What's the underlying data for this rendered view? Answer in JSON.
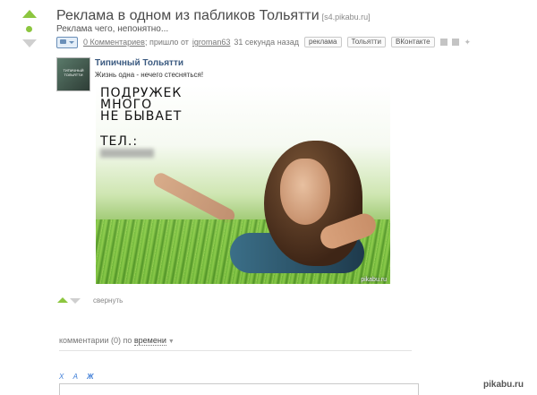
{
  "post": {
    "title": "Реклама в одном из пабликов Тольятти",
    "source": "[s4.pikabu.ru]",
    "subtitle": "Реклама чего, непонятно...",
    "comments_link": "0 Комментариев",
    "posted_prefix": "; пришло от",
    "author": "igroman63",
    "posted_time": "31 секунда назад",
    "tags": [
      "реклама",
      "Тольятти",
      "ВКонтакте"
    ]
  },
  "group": {
    "avatar_label": "ТИПИЧНЫЙ ТОЛЬЯТТИ",
    "name": "Типичный Тольятти",
    "description": "Жизнь одна - нечего стесняться!"
  },
  "ad_image": {
    "line1": "ПОДРУЖЕК",
    "line2": "МНОГО",
    "line3": "НЕ БЫВАЕТ",
    "tel": "ТЕЛ.:",
    "watermark": "pikabu.ru"
  },
  "actions": {
    "collapse_label": "свернуть"
  },
  "comments": {
    "header_prefix": "комментарии (0) по",
    "sort_label": "времени",
    "format_buttons": [
      "Х",
      "А",
      "Ж"
    ]
  },
  "site_watermark": "pikabu.ru",
  "colors": {
    "vote_up": "#8cc63f",
    "vote_down": "#cfcfcf",
    "link": "#3b5a80"
  }
}
